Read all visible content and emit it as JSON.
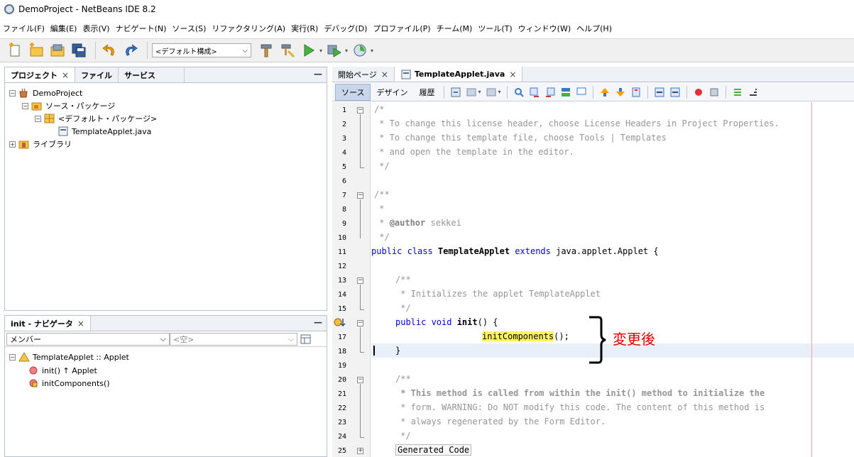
{
  "window": {
    "title": "DemoProject - NetBeans IDE 8.2"
  },
  "menu": [
    "ファイル(F)",
    "編集(E)",
    "表示(V)",
    "ナビゲート(N)",
    "ソース(S)",
    "リファクタリング(A)",
    "実行(R)",
    "デバッグ(D)",
    "プロファイル(P)",
    "チーム(M)",
    "ツール(T)",
    "ウィンドウ(W)",
    "ヘルプ(H)"
  ],
  "toolbar": {
    "config": "<デフォルト構成>"
  },
  "projects_panel": {
    "tabs": [
      "プロジェクト",
      "ファイル",
      "サービス"
    ],
    "tree": {
      "project": "DemoProject",
      "source_packages": "ソース・パッケージ",
      "default_package": "<デフォルト・パッケージ>",
      "file": "TemplateApplet.java",
      "libraries": "ライブラリ"
    }
  },
  "navigator": {
    "title": "init - ナビゲータ",
    "filter_label": "メンバー",
    "filter_value": "<空>",
    "class_node": "TemplateApplet :: Applet",
    "members": [
      "init() ↑ Applet",
      "initComponents()"
    ]
  },
  "editor": {
    "tabs": [
      "開始ページ",
      "TemplateApplet.java"
    ],
    "modes": [
      "ソース",
      "デザイン",
      "履歴"
    ],
    "line_numbers": [
      "1",
      "2",
      "3",
      "4",
      "5",
      "6",
      "7",
      "8",
      "9",
      "10",
      "11",
      "12",
      "13",
      "14",
      "15",
      "16",
      "17",
      "18",
      "19",
      "20",
      "21",
      "22",
      "23",
      "24",
      "25"
    ],
    "code": {
      "l1": "/*",
      "l2": " * To change this license header, choose License Headers in Project Properties.",
      "l3": " * To change this template file, choose Tools | Templates",
      "l4": " * and open the template in the editor.",
      "l5": " */",
      "l7": "/**",
      "l8": " *",
      "l9_a": " * ",
      "l9_tag": "@author",
      "l9_b": " sekkei",
      "l10": " */",
      "l11_kw": "public class ",
      "l11_cls": "TemplateApplet",
      "l11_kw2": " extends ",
      "l11_rest": "java.applet.Applet {",
      "l13": "/**",
      "l14": " * Initializes the applet TemplateApplet",
      "l15": " */",
      "l16_kw": "public void ",
      "l16_name": "init",
      "l16_rest": "() {",
      "l17_call": "initComponents",
      "l17_rest": "();",
      "l18": "}",
      "l20": "/**",
      "l21": " * This method is called from within the init() method to initialize the",
      "l22": " * form. WARNING: Do NOT modify this code. The content of this method is",
      "l23": " * always regenerated by the Form Editor.",
      "l24": " */",
      "l25": "Generated Code"
    }
  },
  "annotation": {
    "text": "変更後"
  },
  "colors": {
    "keyword": "#0000e6",
    "comment": "#969696",
    "annotation": "#e00000",
    "highlight": "#fff45e"
  }
}
